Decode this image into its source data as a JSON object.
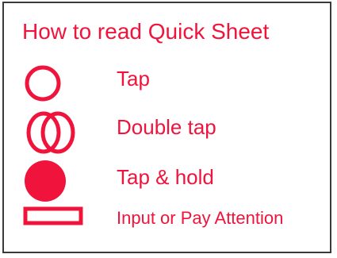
{
  "colors": {
    "accent": "#f0143c",
    "border": "#3a3a3a",
    "background": "#ffffff"
  },
  "legend": {
    "title": "How to read Quick Sheet",
    "items": [
      {
        "icon": "single-ring-icon",
        "label": "Tap"
      },
      {
        "icon": "double-ring-icon",
        "label": "Double tap"
      },
      {
        "icon": "filled-circle-icon",
        "label": "Tap & hold"
      },
      {
        "icon": "outlined-rectangle-icon",
        "label": "Input or Pay Attention"
      }
    ]
  }
}
